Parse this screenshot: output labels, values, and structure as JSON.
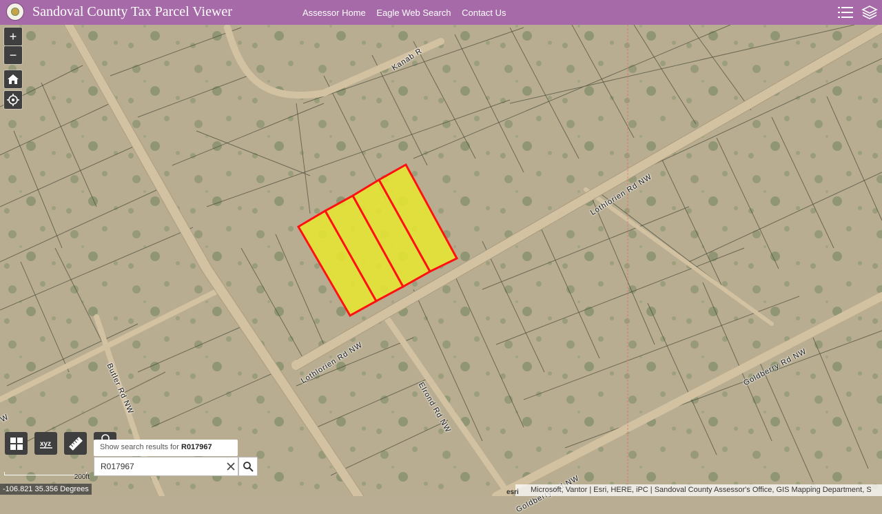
{
  "header": {
    "title": "Sandoval County Tax Parcel Viewer",
    "nav": [
      "Assessor Home",
      "Eagle Web Search",
      "Contact Us"
    ]
  },
  "colors": {
    "header_bg": "#a66aa8",
    "parcel_fill": "#e6e631",
    "parcel_outline": "#ff1111",
    "control_bg": "#3f3f3f"
  },
  "icons": {
    "zoom_in": "plus-icon",
    "zoom_out": "minus-icon",
    "home": "home-icon",
    "locate": "locate-icon",
    "basemap": "basemap-gallery-icon",
    "coordinate": "xyz-coordinate-icon",
    "measure": "ruler-icon",
    "layers": "layers-icon",
    "legend": "list-icon"
  },
  "map": {
    "road_labels": {
      "kanab": "Kanab R",
      "lothlorien_upper": "Lothlorien Rd NW",
      "lothlorien_lower": "Lothlorien Rd NW",
      "butler": "Butler Rd NW",
      "elrond": "Elrond Rd NW",
      "goldberry_right": "Goldberry Rd NW",
      "goldberry_bottom": "Goldberry Rd NW",
      "edge_left": "W"
    },
    "zoom_in_label": "+",
    "zoom_out_label": "−"
  },
  "search": {
    "tip_prefix": "Show search results for ",
    "tip_term": "R017967",
    "value": "R017967"
  },
  "scale": {
    "label": "200ft"
  },
  "coordinates": "-106.821 35.356 Degrees",
  "attribution": "Microsoft, Vantor | Esri, HERE, iPC | Sandoval County Assessor's Office, GIS Mapping Department, S"
}
